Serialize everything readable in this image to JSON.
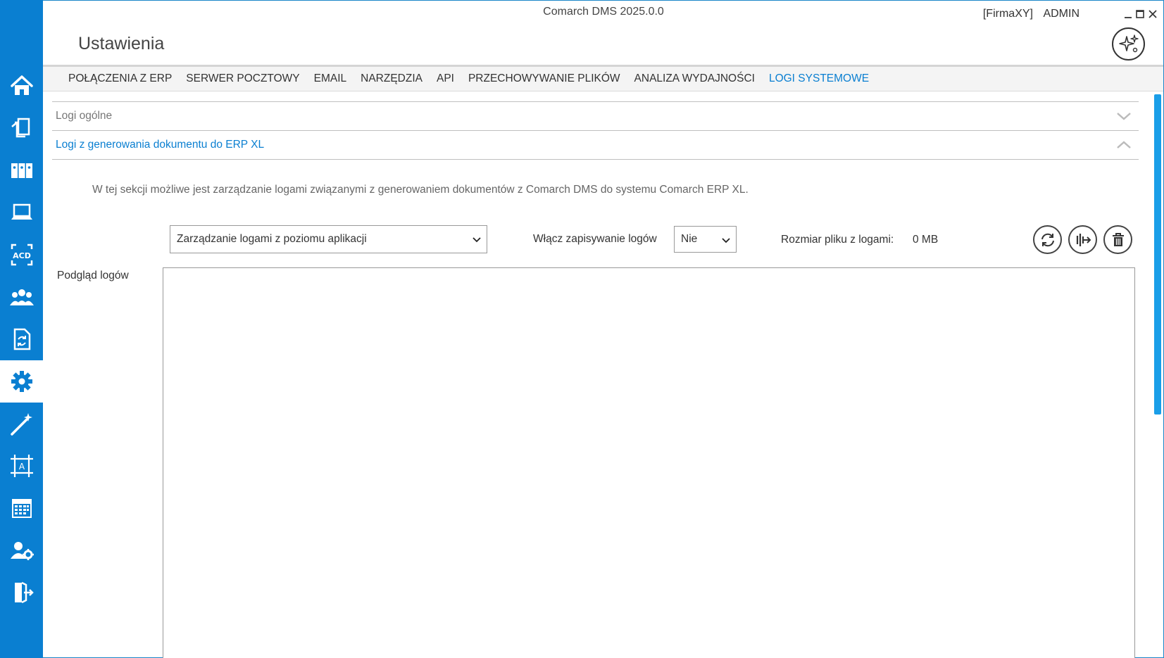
{
  "window": {
    "title": "Comarch DMS 2025.0.0",
    "company": "[FirmaXY]",
    "user": "ADMIN"
  },
  "page": {
    "title": "Ustawienia"
  },
  "sidebar": {
    "items": [
      {
        "icon": "home-icon"
      },
      {
        "icon": "documents-icon"
      },
      {
        "icon": "binders-icon"
      },
      {
        "icon": "laptop-icon"
      },
      {
        "icon": "acd-icon",
        "text": "ACD"
      },
      {
        "icon": "users-icon"
      },
      {
        "icon": "document-sync-icon"
      },
      {
        "icon": "gear-icon",
        "active": true
      },
      {
        "icon": "magic-wand-icon"
      },
      {
        "icon": "template-editor-icon",
        "text": "A"
      },
      {
        "icon": "calendar-icon"
      },
      {
        "icon": "user-settings-icon"
      },
      {
        "icon": "logout-icon"
      }
    ]
  },
  "tabs": [
    {
      "label": "POŁĄCZENIA Z ERP"
    },
    {
      "label": "SERWER POCZTOWY"
    },
    {
      "label": "EMAIL"
    },
    {
      "label": "NARZĘDZIA"
    },
    {
      "label": "API"
    },
    {
      "label": "PRZECHOWYWANIE PLIKÓW"
    },
    {
      "label": "ANALIZA WYDAJNOŚCI"
    },
    {
      "label": "LOGI SYSTEMOWE",
      "active": true
    }
  ],
  "sections": {
    "general": {
      "label": "Logi ogólne",
      "expanded": false
    },
    "erp": {
      "label": "Logi z generowania dokumentu do ERP XL",
      "expanded": true
    }
  },
  "erp_section": {
    "description": "W tej sekcji możliwe jest zarządzanie logami związanymi z generowaniem dokumentów z Comarch DMS do systemu Comarch ERP XL.",
    "mode_select": "Zarządzanie logami z poziomu aplikacji",
    "enable_label": "Włącz zapisywanie logów",
    "enable_value": "Nie",
    "size_label": "Rozmiar pliku z logami:",
    "size_value": "0 MB",
    "preview_label": "Podgląd logów",
    "log_content": ""
  },
  "colors": {
    "accent": "#0a7fd1",
    "scrollbar": "#1a9ee8"
  }
}
